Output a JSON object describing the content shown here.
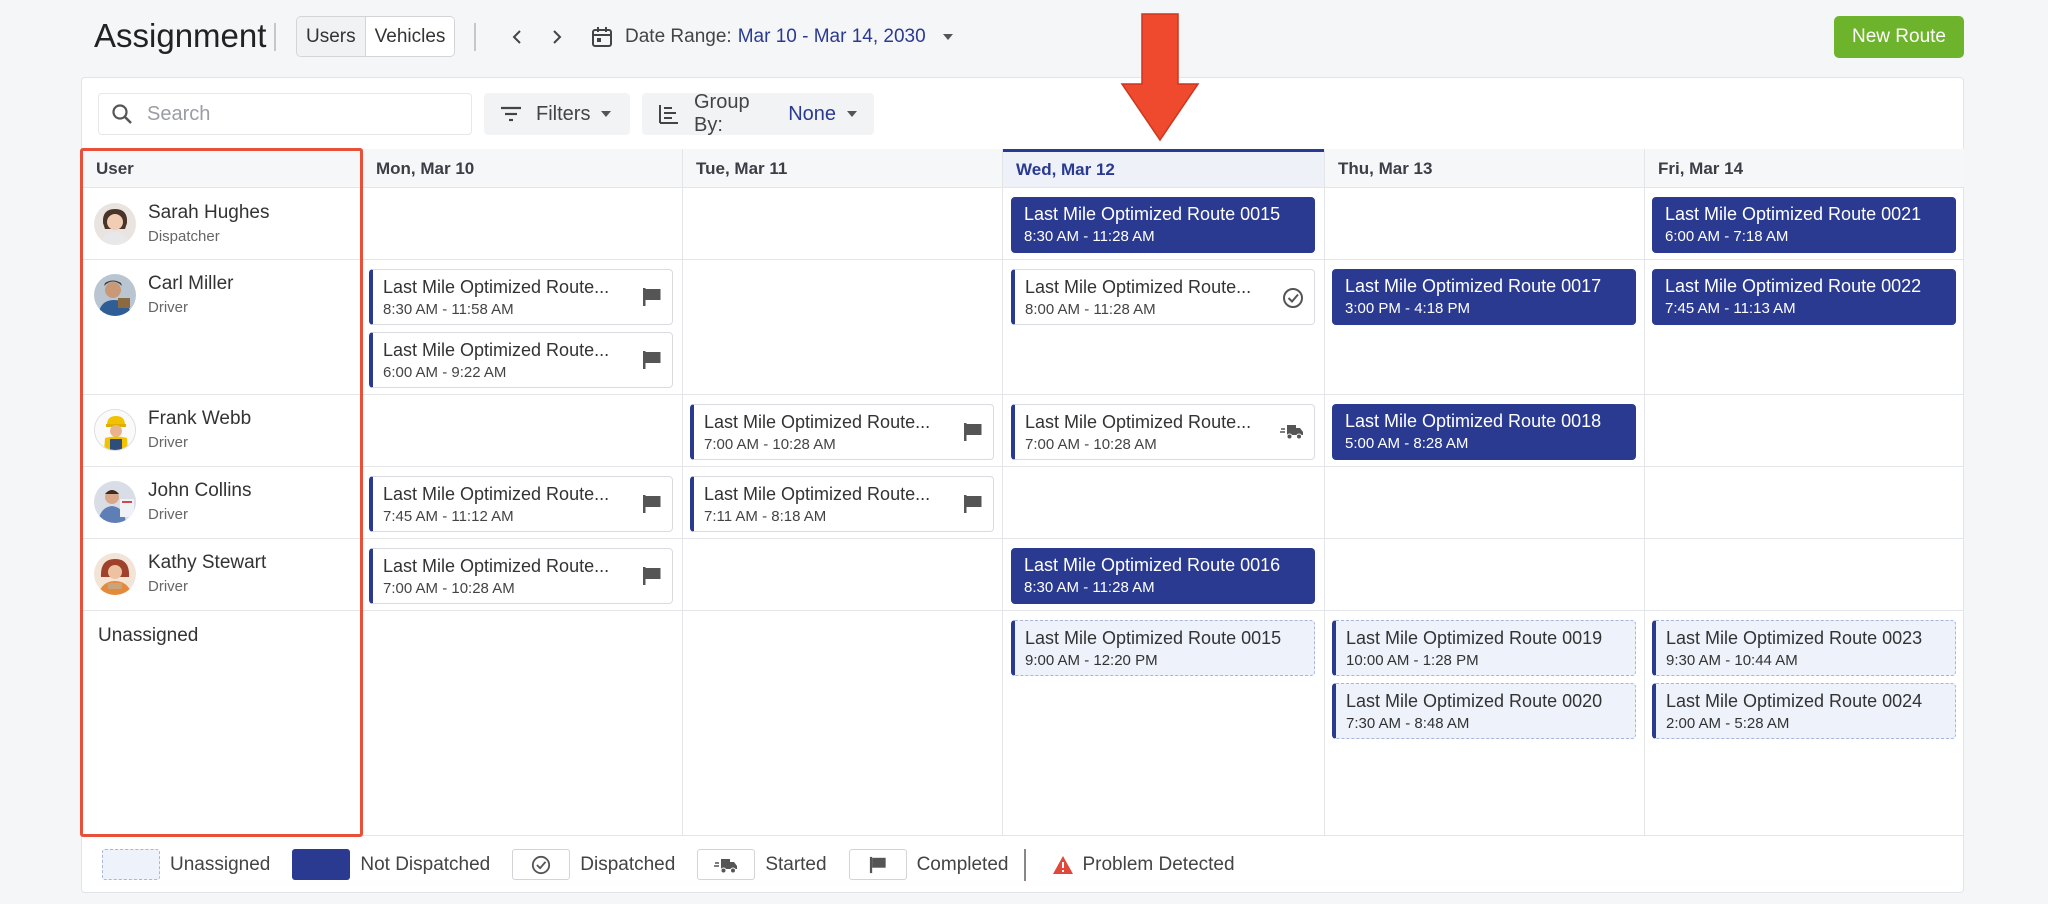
{
  "header": {
    "title": "Assignment",
    "view_toggle": [
      "Users",
      "Vehicles"
    ],
    "active_view": "Users",
    "date_range_label": "Date Range:",
    "date_range_value": "Mar 10 - Mar 14, 2030",
    "new_route_label": "New Route"
  },
  "toolbar": {
    "search_placeholder": "Search",
    "filters_label": "Filters",
    "group_by_label": "Group By:",
    "group_by_value": "None"
  },
  "columns": {
    "user": "User",
    "days": [
      "Mon, Mar 10",
      "Tue, Mar 11",
      "Wed, Mar 12",
      "Thu, Mar 13",
      "Fri, Mar 14"
    ],
    "today_index": 2
  },
  "users": [
    {
      "name": "Sarah Hughes",
      "role": "Dispatcher"
    },
    {
      "name": "Carl Miller",
      "role": "Driver"
    },
    {
      "name": "Frank Webb",
      "role": "Driver"
    },
    {
      "name": "John Collins",
      "role": "Driver"
    },
    {
      "name": "Kathy Stewart",
      "role": "Driver"
    }
  ],
  "unassigned_label": "Unassigned",
  "routes": {
    "r1": {
      "title": "Last Mile Optimized Route 0015",
      "time": "8:30 AM - 11:28 AM",
      "status": "not-dispatched"
    },
    "r2": {
      "title": "Last Mile Optimized Route 0021",
      "time": "6:00 AM - 7:18 AM",
      "status": "not-dispatched"
    },
    "r3": {
      "title": "Last Mile Optimized Route...",
      "time": "8:30 AM - 11:58 AM",
      "status": "completed"
    },
    "r4": {
      "title": "Last Mile Optimized Route...",
      "time": "6:00 AM - 9:22 AM",
      "status": "completed"
    },
    "r5": {
      "title": "Last Mile Optimized Route...",
      "time": "8:00 AM - 11:28 AM",
      "status": "dispatched"
    },
    "r6": {
      "title": "Last Mile Optimized Route 0017",
      "time": "3:00 PM - 4:18 PM",
      "status": "not-dispatched"
    },
    "r7": {
      "title": "Last Mile Optimized Route 0022",
      "time": "7:45 AM - 11:13 AM",
      "status": "not-dispatched"
    },
    "r8": {
      "title": "Last Mile Optimized Route...",
      "time": "7:00 AM - 10:28 AM",
      "status": "completed"
    },
    "r9": {
      "title": "Last Mile Optimized Route...",
      "time": "7:00 AM - 10:28 AM",
      "status": "started"
    },
    "r10": {
      "title": "Last Mile Optimized Route 0018",
      "time": "5:00 AM - 8:28 AM",
      "status": "not-dispatched"
    },
    "r11": {
      "title": "Last Mile Optimized Route...",
      "time": "7:45 AM - 11:12 AM",
      "status": "completed"
    },
    "r12": {
      "title": "Last Mile Optimized Route...",
      "time": "7:11 AM - 8:18 AM",
      "status": "completed"
    },
    "r13": {
      "title": "Last Mile Optimized Route...",
      "time": "7:00 AM - 10:28 AM",
      "status": "completed"
    },
    "r14": {
      "title": "Last Mile Optimized Route 0016",
      "time": "8:30 AM - 11:28 AM",
      "status": "not-dispatched"
    },
    "r15": {
      "title": "Last Mile Optimized Route 0015",
      "time": "9:00 AM - 12:20 PM",
      "status": "unassigned"
    },
    "r16": {
      "title": "Last Mile Optimized Route 0019",
      "time": "10:00 AM - 1:28 PM",
      "status": "unassigned"
    },
    "r17": {
      "title": "Last Mile Optimized Route 0020",
      "time": "7:30 AM - 8:48 AM",
      "status": "unassigned"
    },
    "r18": {
      "title": "Last Mile Optimized Route 0023",
      "time": "9:30 AM - 10:44 AM",
      "status": "unassigned"
    },
    "r19": {
      "title": "Last Mile Optimized Route 0024",
      "time": "2:00 AM - 5:28 AM",
      "status": "unassigned"
    }
  },
  "legend": {
    "unassigned": "Unassigned",
    "not_dispatched": "Not Dispatched",
    "dispatched": "Dispatched",
    "started": "Started",
    "completed": "Completed",
    "problem": "Problem Detected"
  },
  "colors": {
    "accent": "#2a3a91",
    "new_route": "#6db32b",
    "highlight": "#e8503a",
    "problem": "#e0493a"
  }
}
